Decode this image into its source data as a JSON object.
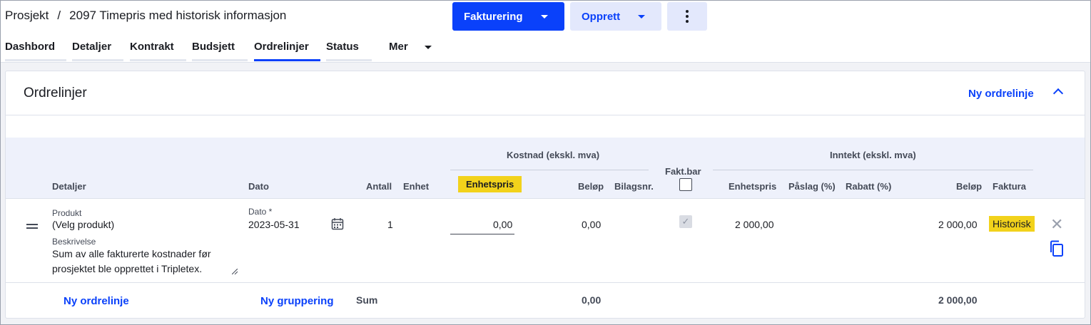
{
  "header": {
    "breadcrumb_root": "Prosjekt",
    "breadcrumb_sep": "/",
    "breadcrumb_current": "2097 Timepris med historisk informasjon",
    "invoice_button": "Fakturering",
    "create_button": "Opprett"
  },
  "tabs": [
    {
      "label": "Dashbord"
    },
    {
      "label": "Detaljer"
    },
    {
      "label": "Kontrakt"
    },
    {
      "label": "Budsjett"
    },
    {
      "label": "Ordrelinjer",
      "active": true
    },
    {
      "label": "Status"
    },
    {
      "label": "Mer"
    }
  ],
  "card": {
    "title": "Ordrelinjer",
    "new_line_link": "Ny ordrelinje"
  },
  "table": {
    "group_cost": "Kostnad (ekskl. mva)",
    "group_income": "Inntekt (ekskl. mva)",
    "col_details": "Detaljer",
    "col_date": "Dato",
    "col_qty": "Antall",
    "col_unit": "Enhet",
    "col_cost_unit_price": "Enhetspris",
    "col_cost_amount": "Beløp",
    "col_voucher": "Bilagsnr.",
    "col_billable": "Fakt.bar",
    "col_income_unit_price": "Enhetspris",
    "col_markup": "Påslag (%)",
    "col_discount": "Rabatt (%)",
    "col_income_amount": "Beløp",
    "col_invoice": "Faktura"
  },
  "row": {
    "product_label": "Produkt",
    "product_value": "(Velg produkt)",
    "description_label": "Beskrivelse",
    "description_line1": "Sum av alle fakturerte kostnader før",
    "description_line2": "prosjektet ble opprettet i Tripletex.",
    "date_label": "Dato *",
    "date_value": "2023-05-31",
    "quantity": "1",
    "cost_unit_price": "0,00",
    "cost_amount": "0,00",
    "billable_checked": true,
    "income_unit_price": "2 000,00",
    "income_amount": "2 000,00",
    "invoice_badge": "Historisk"
  },
  "footer": {
    "new_line": "Ny ordrelinje",
    "new_group": "Ny gruppering",
    "sum_label": "Sum",
    "sum_cost": "0,00",
    "sum_income": "2 000,00"
  },
  "colors": {
    "primary": "#0a41fa",
    "highlight": "#f2d21b"
  }
}
